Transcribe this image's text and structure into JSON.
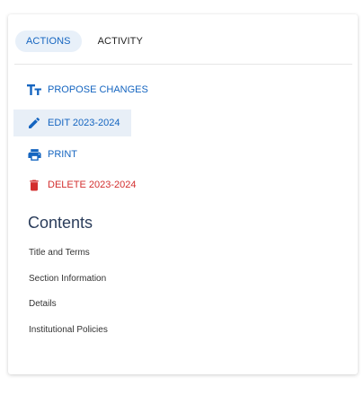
{
  "tabs": {
    "actions": "ACTIONS",
    "activity": "ACTIVITY"
  },
  "actions": {
    "propose": "PROPOSE CHANGES",
    "edit": "EDIT 2023-2024",
    "print": "PRINT",
    "delete": "DELETE 2023-2024"
  },
  "icons": {
    "propose": "text-size-icon",
    "edit": "pencil-icon",
    "print": "printer-icon",
    "delete": "trash-icon"
  },
  "colors": {
    "accent": "#1565c0",
    "danger": "#d32f2f",
    "heading": "#2b3d5b"
  },
  "contents": {
    "title": "Contents",
    "items": [
      "Title and Terms",
      "Section Information",
      "Details",
      "Institutional Policies"
    ]
  }
}
